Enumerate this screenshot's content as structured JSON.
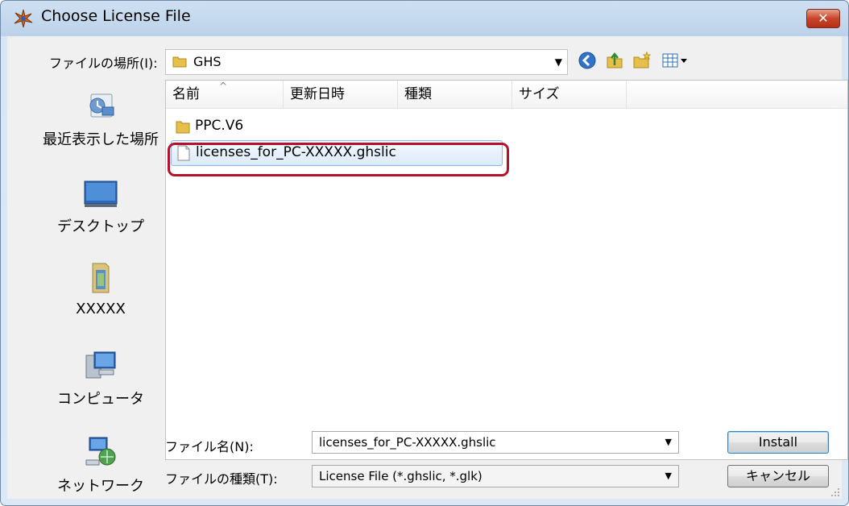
{
  "window": {
    "title": "Choose License File",
    "close_glyph": "✕"
  },
  "lookin": {
    "label": "ファイルの場所(I):",
    "value": "GHS"
  },
  "toolbar_icons": [
    "back-icon",
    "up-folder-icon",
    "new-folder-icon",
    "views-menu-icon"
  ],
  "places": [
    {
      "label": "最近表示した場所",
      "icon": "recent-places-icon"
    },
    {
      "label": "デスクトップ",
      "icon": "desktop-icon"
    },
    {
      "label": "XXXXX",
      "icon": "user-folder-icon"
    },
    {
      "label": "コンピュータ",
      "icon": "computer-icon"
    },
    {
      "label": "ネットワーク",
      "icon": "network-icon"
    }
  ],
  "columns": [
    "名前",
    "更新日時",
    "種類",
    "サイズ"
  ],
  "files": [
    {
      "name": "PPC.V6",
      "type": "folder"
    },
    {
      "name": "licenses_for_PC-XXXXX.ghslic",
      "type": "file",
      "selected": true
    }
  ],
  "filename": {
    "label": "ファイル名(N):",
    "value": "licenses_for_PC-XXXXX.ghslic"
  },
  "filetype": {
    "label": "ファイルの種類(T):",
    "value": "License File (*.ghslic, *.glk)"
  },
  "buttons": {
    "install": "Install",
    "cancel": "キャンセル"
  },
  "colors": {
    "highlight": "#b8102a",
    "selection": "#dcebfc",
    "close_button": "#c7452b"
  }
}
